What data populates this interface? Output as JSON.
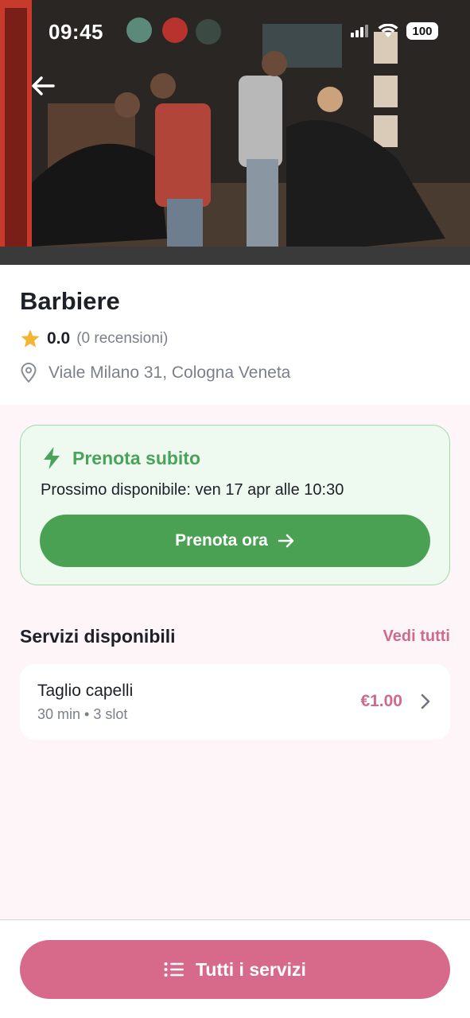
{
  "status_bar": {
    "time": "09:45",
    "battery": "100",
    "icons": [
      "signal-icon",
      "wifi-icon",
      "battery-icon"
    ]
  },
  "header": {
    "back_icon": "arrow-left-icon"
  },
  "shop": {
    "name": "Barbiere",
    "rating": "0.0",
    "reviews": "(0 recensioni)",
    "address": "Viale Milano 31, Cologna Veneta"
  },
  "book_now": {
    "title": "Prenota subito",
    "next_available": "Prossimo disponibile: ven 17 apr alle 10:30",
    "button_label": "Prenota ora"
  },
  "services": {
    "title": "Servizi disponibili",
    "see_all": "Vedi tutti",
    "items": [
      {
        "name": "Taglio capelli",
        "meta": "30 min • 3 slot",
        "price": "€1.00"
      }
    ]
  },
  "bottom": {
    "button_label": "Tutti i servizi"
  },
  "colors": {
    "green_accent": "#4aa153",
    "pink_accent": "#d76a8a",
    "price_pink": "#cf6a8c",
    "star": "#f2b632"
  }
}
